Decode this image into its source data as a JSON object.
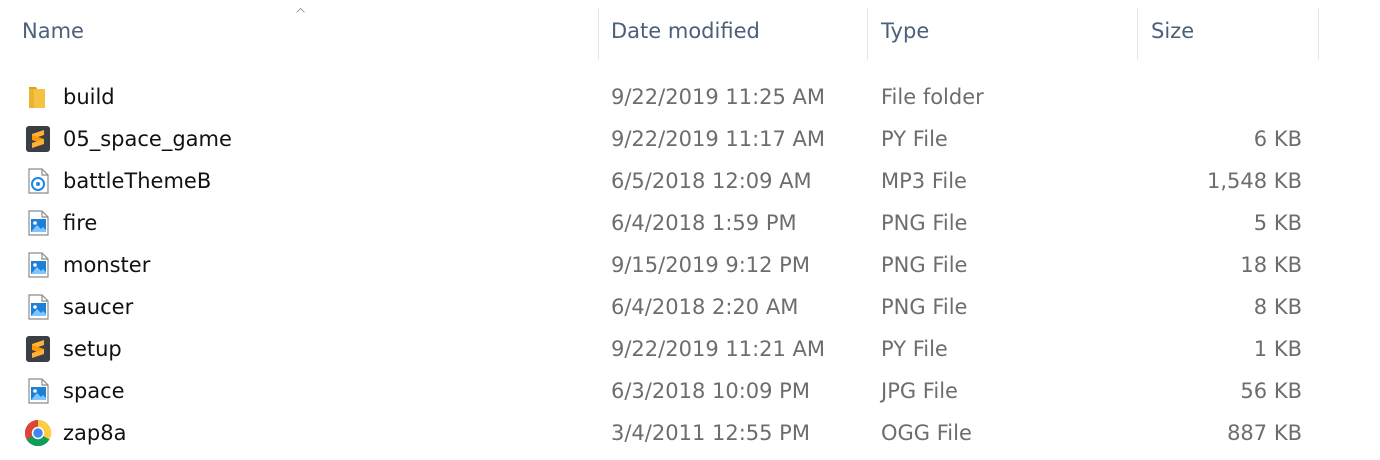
{
  "columns": {
    "name": "Name",
    "date": "Date modified",
    "type": "Type",
    "size": "Size"
  },
  "sort": {
    "column": "name",
    "direction": "ascending",
    "icon": "sort-up-chevron-icon"
  },
  "files": [
    {
      "icon": "folder-icon",
      "name": "build",
      "date": "9/22/2019 11:25 AM",
      "type": "File folder",
      "size": ""
    },
    {
      "icon": "sublime-text-icon",
      "name": "05_space_game",
      "date": "9/22/2019 11:17 AM",
      "type": "PY File",
      "size": "6 KB"
    },
    {
      "icon": "audio-file-icon",
      "name": "battleThemeB",
      "date": "6/5/2018 12:09 AM",
      "type": "MP3 File",
      "size": "1,548 KB"
    },
    {
      "icon": "image-file-icon",
      "name": "fire",
      "date": "6/4/2018 1:59 PM",
      "type": "PNG File",
      "size": "5 KB"
    },
    {
      "icon": "image-file-icon",
      "name": "monster",
      "date": "9/15/2019 9:12 PM",
      "type": "PNG File",
      "size": "18 KB"
    },
    {
      "icon": "image-file-icon",
      "name": "saucer",
      "date": "6/4/2018 2:20 AM",
      "type": "PNG File",
      "size": "8 KB"
    },
    {
      "icon": "sublime-text-icon",
      "name": "setup",
      "date": "9/22/2019 11:21 AM",
      "type": "PY File",
      "size": "1 KB"
    },
    {
      "icon": "image-file-icon",
      "name": "space",
      "date": "6/3/2018 10:09 PM",
      "type": "JPG File",
      "size": "56 KB"
    },
    {
      "icon": "chrome-icon",
      "name": "zap8a",
      "date": "3/4/2011 12:55 PM",
      "type": "OGG File",
      "size": "887 KB"
    }
  ],
  "colors": {
    "header_text": "#4c607a",
    "name_text": "#111111",
    "detail_text": "#6d6d6d",
    "folder": "#f5c242",
    "sublime": "#ff9800"
  }
}
